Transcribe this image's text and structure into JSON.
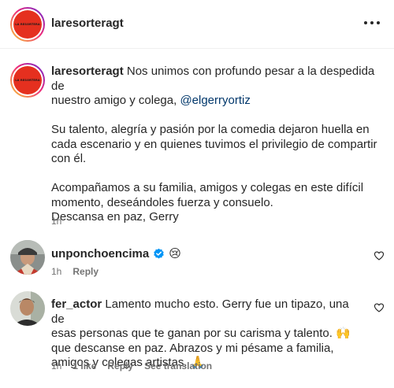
{
  "post": {
    "author": "laresorteragt",
    "brand_avatar_text": "LA RESORTERA",
    "caption": {
      "author": "laresorteragt",
      "line1": " Nos unimos con profundo pesar a la despedida de",
      "line2_before": "nuestro amigo y colega, ",
      "mention": "@elgerryortiz",
      "p2_line1": "Su talento, alegría y pasión por la comedia dejaron huella en",
      "p2_line2": "cada escenario y en quienes tuvimos el privilegio de compartir",
      "p2_line3": "con él.",
      "p3_line1": "Acompañamos a su familia, amigos y colegas en este difícil",
      "p3_line2": "momento, deseándoles fuerza y consuelo.",
      "p3_line3": "Descansa en paz, Gerry",
      "time": "1h"
    }
  },
  "comments": [
    {
      "user": "unponchoencima",
      "verified": true,
      "emoji": "😢",
      "time": "1h",
      "reply": "Reply"
    },
    {
      "user": "fer_actor",
      "line1": " Lamento mucho esto. Gerry fue un tipazo, una de",
      "line2": "esas personas que te ganan por su carisma y talento. 🙌",
      "line3": "que descanse en paz. Abrazos y mi pésame a familia,",
      "line4": "amigos y colegas artistas. 🙏",
      "time": "1h",
      "likes": "1 like",
      "reply": "Reply",
      "translate": "See translation"
    }
  ],
  "icons": {
    "more": "more-horizontal-icon",
    "heart": "heart-outline-icon",
    "verified": "verified-badge-icon"
  },
  "colors": {
    "brand_red": "#e5301f",
    "verified_blue": "#0095f6",
    "mention": "#00376b",
    "meta_gray": "#737373"
  }
}
